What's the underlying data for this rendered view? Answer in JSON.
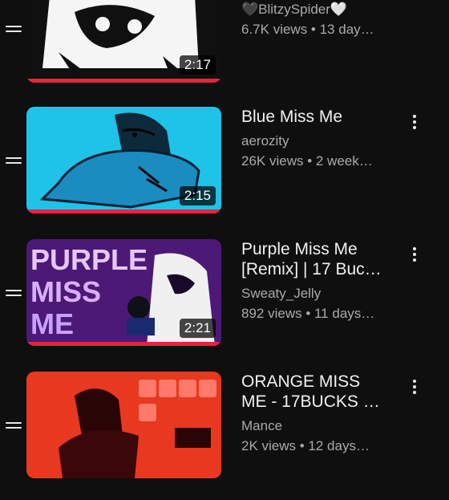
{
  "videos": [
    {
      "title": "",
      "title_line2": "",
      "channel": "🖤BlitzySpider🤍",
      "meta": "6.7K views • 13 day…",
      "duration": "2:17",
      "progress": 1.0,
      "thumb_color": "#111111"
    },
    {
      "title": "Blue Miss Me",
      "title_line2": "",
      "channel": "aerozity",
      "meta": "26K views • 2 week…",
      "duration": "2:15",
      "progress": 1.0,
      "thumb_color": "#1fc3e8"
    },
    {
      "title": "Purple Miss Me",
      "title_line2": "[Remix] | 17 Buc…",
      "channel": "Sweaty_Jelly",
      "meta": "892 views • 11 days…",
      "duration": "2:21",
      "progress": 1.0,
      "thumb_color": "#5a1a8f"
    },
    {
      "title": "ORANGE MISS",
      "title_line2": "ME - 17BUCKS …",
      "channel": "Mance",
      "meta": "2K views • 12 days…",
      "duration": "",
      "progress": 1.0,
      "thumb_color": "#e8381f"
    }
  ],
  "thumb_text": {
    "purple": "PURPLE MISS ME"
  },
  "icons": {
    "drag": "drag-handle-icon",
    "more": "more-vert-icon"
  }
}
